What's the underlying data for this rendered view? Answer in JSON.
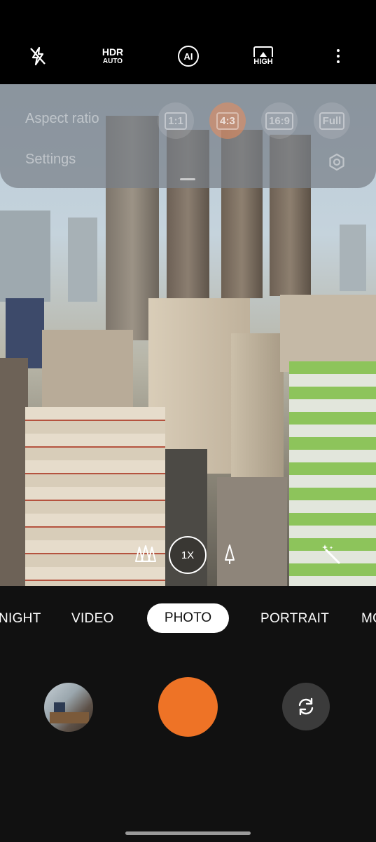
{
  "top_bar": {
    "flash_icon": "flash-off-icon",
    "hdr": {
      "line1": "HDR",
      "line2": "AUTO"
    },
    "ai_label": "AI",
    "quality_label": "HIGH",
    "more_icon": "more-vertical-icon"
  },
  "settings_panel": {
    "aspect_ratio_label": "Aspect ratio",
    "settings_label": "Settings",
    "ratios": [
      "1:1",
      "4:3",
      "16:9",
      "Full"
    ],
    "selected_ratio": "4:3"
  },
  "zoom": {
    "wide_icon": "trees-wide-icon",
    "level": "1X",
    "tele_icon": "tree-tele-icon",
    "magic_icon": "magic-wand-icon"
  },
  "modes": {
    "night": "NIGHT",
    "video": "VIDEO",
    "photo": "PHOTO",
    "portrait": "PORTRAIT",
    "more": "MO"
  },
  "colors": {
    "shutter": "#ee7326",
    "mode_active_bg": "#ffffff"
  }
}
